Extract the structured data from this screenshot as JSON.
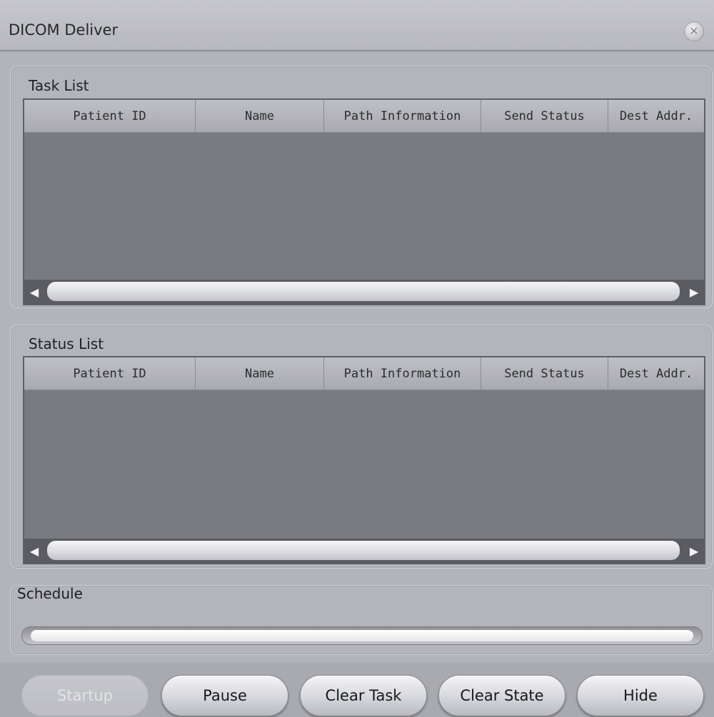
{
  "window": {
    "title": "DICOM Deliver",
    "close_icon": "close-icon"
  },
  "task_list": {
    "title": "Task List",
    "columns": [
      "Patient ID",
      "Name",
      "Path Information",
      "Send Status",
      "Dest Addr."
    ],
    "rows": []
  },
  "status_list": {
    "title": "Status List",
    "columns": [
      "Patient ID",
      "Name",
      "Path Information",
      "Send Status",
      "Dest Addr."
    ],
    "rows": []
  },
  "schedule": {
    "title": "Schedule",
    "progress_percent": 0
  },
  "buttons": {
    "startup": "Startup",
    "pause": "Pause",
    "clear_task": "Clear Task",
    "clear_state": "Clear State",
    "hide": "Hide"
  },
  "colors": {
    "grid_body": "#7a7b80",
    "panel_bg": "#b4b5bb",
    "scroll_track": "#5b5c61"
  }
}
